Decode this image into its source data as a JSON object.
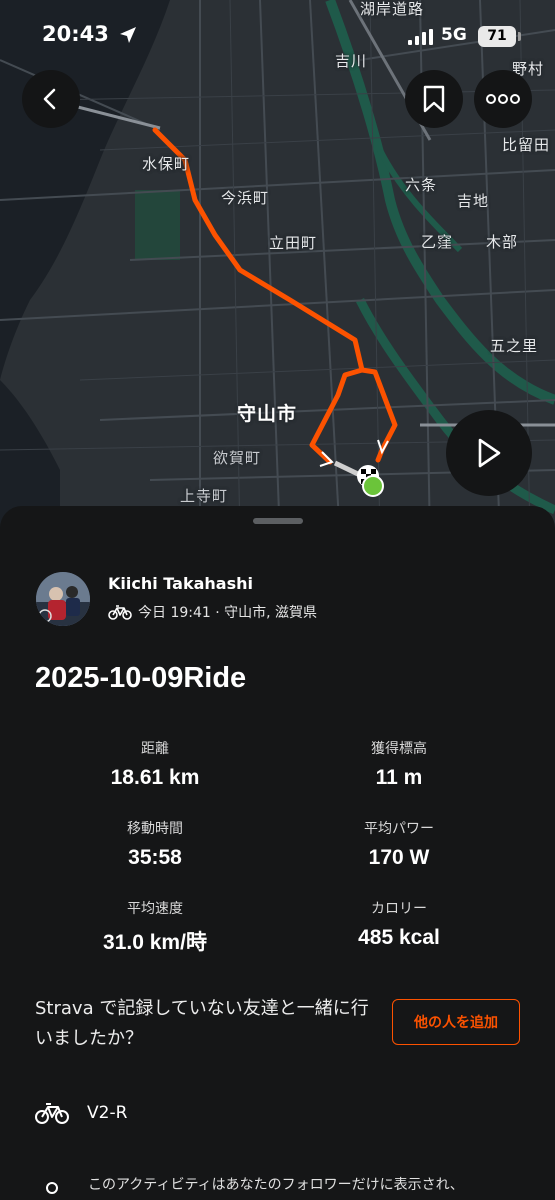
{
  "status_bar": {
    "time": "20:43",
    "network": "5G",
    "battery": "71"
  },
  "map": {
    "labels": {
      "road": "湖岸道路",
      "yoshikawa": "吉川",
      "nomura": "野村",
      "hiruda": "比留田",
      "mihocho": "水保町",
      "imahamacho": "今浜町",
      "rokujo": "六条",
      "yoshiji": "吉地",
      "tatedacho": "立田町",
      "otsuri": "乙窪",
      "kibe": "木部",
      "gonosato": "五之里",
      "moriyama": "守山市",
      "hogacho": "欲賀町",
      "kamiteracho": "上寺町"
    },
    "colors": {
      "route": "#fc5200",
      "land": "#2b3035",
      "water": "#1b2026",
      "river": "#1f5a4a"
    }
  },
  "controls": {
    "back_icon": "chevron-left-icon",
    "bookmark_icon": "bookmark-icon",
    "more_icon": "more-icon",
    "play_icon": "play-icon"
  },
  "activity": {
    "athlete_name": "Kiichi Takahashi",
    "meta": "今日 19:41 · 守山市, 滋賀県",
    "sport_icon": "bike-icon",
    "title": "2025-10-09Ride",
    "stats": [
      {
        "label": "距離",
        "value": "18.61 km"
      },
      {
        "label": "獲得標高",
        "value": "11 m"
      },
      {
        "label": "移動時間",
        "value": "35:58"
      },
      {
        "label": "平均パワー",
        "value": "170 W"
      },
      {
        "label": "平均速度",
        "value": "31.0 km/時"
      },
      {
        "label": "カロリー",
        "value": "485 kcal"
      }
    ],
    "invite_text": "Strava で記録していない友達と一緒に行いましたか？",
    "add_people_label": "他の人を追加",
    "gear": "V2-R",
    "privacy_text": "このアクティビティはあなたのフォロワーだけに表示され、"
  },
  "theme": {
    "accent": "#fc5200",
    "sheet_bg": "#151617"
  }
}
